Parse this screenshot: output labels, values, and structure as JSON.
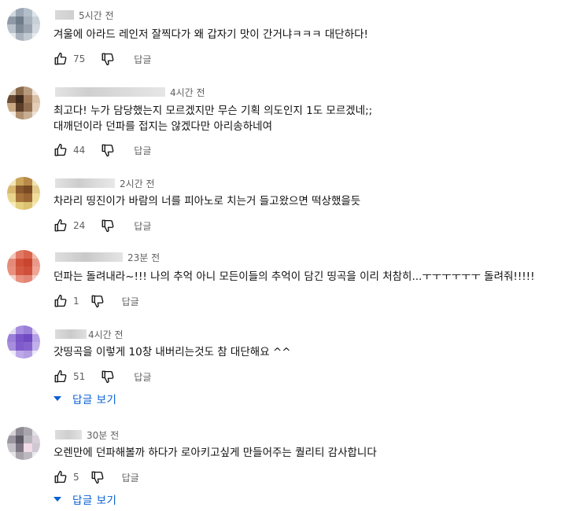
{
  "reply_label": "답글",
  "colors": {
    "link": "#065fd4",
    "meta": "#606060",
    "text": "#0f0f0f"
  },
  "icons": {
    "like": "thumbs-up-icon",
    "dislike": "thumbs-down-icon",
    "expand": "caret-down-icon"
  },
  "comments": [
    {
      "time": "5시간 전",
      "lines": [
        "겨울에 아라드 레인저 잘찍다가 왜 갑자기 맛이 간거냐ㅋㅋㅋ 대단하다!"
      ],
      "likes": "75",
      "view_replies": ""
    },
    {
      "time": "4시간 전",
      "lines": [
        "최고다! 누가 담당했는지 모르겠지만 무슨 기획 의도인지 1도 모르겠네;;",
        "대깨던이라 던파를 접지는 않겠다만 아리송하네여"
      ],
      "likes": "44",
      "view_replies": ""
    },
    {
      "time": "2시간 전",
      "lines": [
        "차라리 띵진이가 바람의 너를 피아노로 치는거 들고왔으면 떡상했을듯"
      ],
      "likes": "24",
      "view_replies": ""
    },
    {
      "time": "23분 전",
      "lines": [
        "던파는 돌려내라~!!! 나의 추억 아니 모든이들의 추억이 담긴 띵곡을 이리 처참히...ㅜㅜㅜㅜㅜㅜ 돌려줘!!!!!"
      ],
      "likes": "1",
      "view_replies": ""
    },
    {
      "time": "4시간 전",
      "lines": [
        "갓띵곡을 이렇게 10창 내버리는것도 참 대단해요 ^^"
      ],
      "likes": "51",
      "view_replies": "답글 보기"
    },
    {
      "time": "30분 전",
      "lines": [
        "오렌만에 던파해볼까 하다가 로아키고싶게 만들어주는 퀄리티 감사합니다"
      ],
      "likes": "5",
      "view_replies": "답글 보기"
    }
  ]
}
